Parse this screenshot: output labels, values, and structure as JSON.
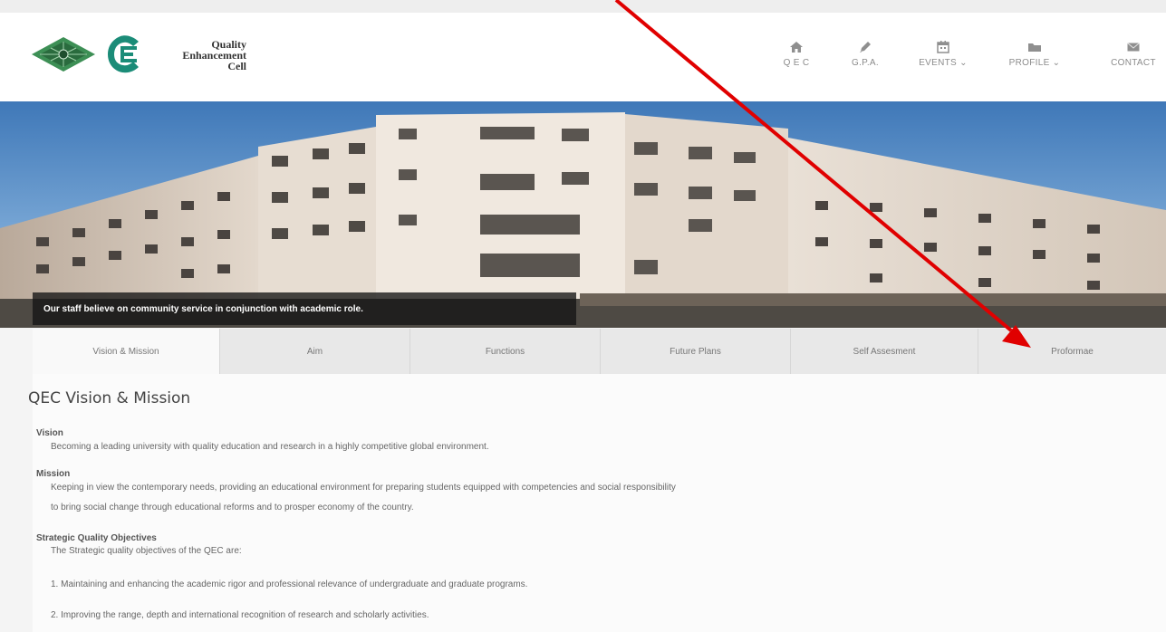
{
  "header": {
    "logo_text_lines": [
      "Quality",
      "Enhancement",
      "Cell"
    ],
    "nav": [
      {
        "label": "Q E C",
        "icon": "home-icon"
      },
      {
        "label": "G.P.A.",
        "icon": "pencil-icon"
      },
      {
        "label": "EVENTS ⌄",
        "icon": "calendar-icon"
      },
      {
        "label": "PROFILE ⌄",
        "icon": "folder-icon"
      },
      {
        "label": "CONTACT",
        "icon": "mail-icon"
      }
    ]
  },
  "banner": {
    "caption": "Our staff believe on community service in conjunction with academic role."
  },
  "tabs": [
    "Vision & Mission",
    "Aim",
    "Functions",
    "Future Plans",
    "Self Assesment",
    "Proformae"
  ],
  "content": {
    "title": "QEC Vision & Mission",
    "vision_label": "Vision",
    "vision_text": "Becoming a leading university with quality education and research in a highly competitive global environment.",
    "mission_label": "Mission",
    "mission_line1": "Keeping in view the contemporary needs, providing an educational environment for preparing students equipped with competencies and social responsibility",
    "mission_line2": "to bring social change through educational reforms and to prosper economy of the country.",
    "objectives_label": "Strategic Quality Objectives",
    "objectives_intro": "The Strategic quality objectives of the QEC are:",
    "objective_1": "1. Maintaining and enhancing the academic rigor and professional relevance of undergraduate and graduate programs.",
    "objective_2": "2. Improving the range, depth and international recognition of research and scholarly activities."
  },
  "colors": {
    "annotation_arrow": "#e00000",
    "logo_green": "#2e7d4a",
    "logo_teal": "#1a8a7a"
  }
}
